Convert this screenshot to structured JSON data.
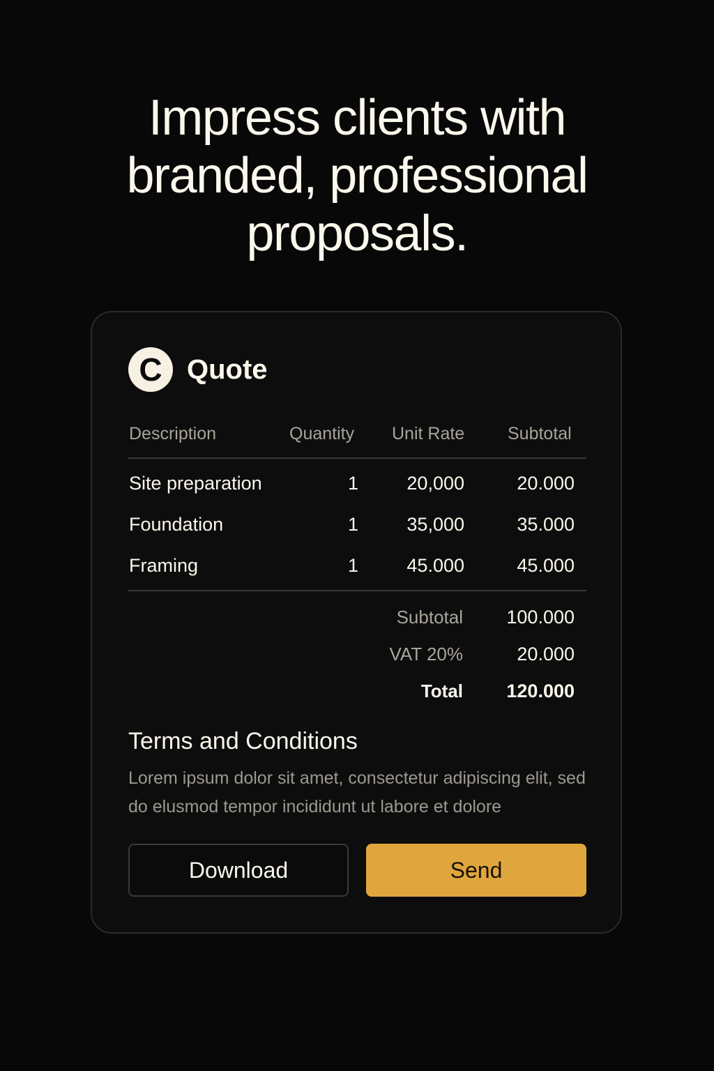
{
  "headline": {
    "line1": "Impress clients with",
    "line2": "branded, professional",
    "line3": "proposals."
  },
  "quote": {
    "logo_letter": "C",
    "title": "Quote",
    "columns": [
      "Description",
      "Quantity",
      "Unit Rate",
      "Subtotal"
    ],
    "rows": [
      {
        "description": "Site preparation",
        "quantity": "1",
        "unit_rate": "20,000",
        "subtotal": "20.000"
      },
      {
        "description": "Foundation",
        "quantity": "1",
        "unit_rate": "35,000",
        "subtotal": "35.000"
      },
      {
        "description": "Framing",
        "quantity": "1",
        "unit_rate": "45.000",
        "subtotal": "45.000"
      }
    ],
    "summary": {
      "subtotal_label": "Subtotal",
      "subtotal_value": "100.000",
      "vat_label": "VAT 20%",
      "vat_value": "20.000",
      "total_label": "Total",
      "total_value": "120.000"
    },
    "terms": {
      "title": "Terms and Conditions",
      "body": "Lorem ipsum dolor sit amet, consectetur adipiscing elit, sed do elusmod tempor incididunt ut labore et dolore"
    },
    "buttons": {
      "download": "Download",
      "send": "Send"
    }
  },
  "colors": {
    "background": "#080808",
    "card": "#0d0d0d",
    "accent": "#e0a63e",
    "text": "#fbf7ec",
    "muted": "#a8a49b"
  }
}
